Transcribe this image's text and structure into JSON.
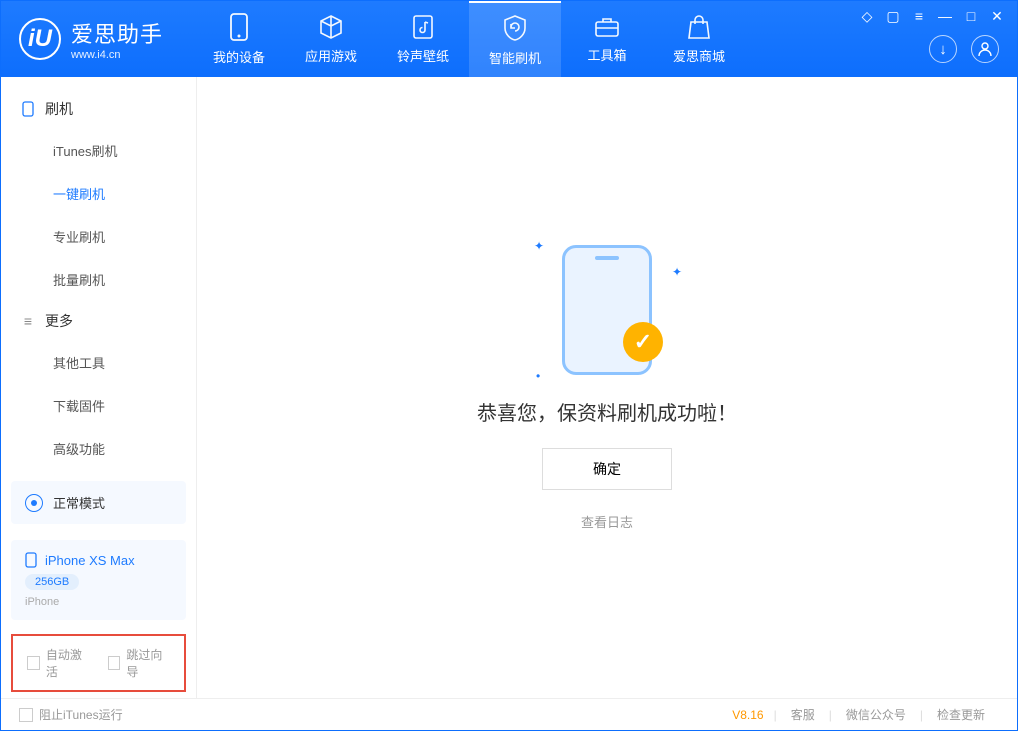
{
  "app": {
    "title": "爱思助手",
    "subtitle": "www.i4.cn"
  },
  "tabs": [
    {
      "label": "我的设备"
    },
    {
      "label": "应用游戏"
    },
    {
      "label": "铃声壁纸"
    },
    {
      "label": "智能刷机"
    },
    {
      "label": "工具箱"
    },
    {
      "label": "爱思商城"
    }
  ],
  "sidebar": {
    "group1": {
      "title": "刷机"
    },
    "items1": [
      {
        "label": "iTunes刷机"
      },
      {
        "label": "一键刷机"
      },
      {
        "label": "专业刷机"
      },
      {
        "label": "批量刷机"
      }
    ],
    "group2": {
      "title": "更多"
    },
    "items2": [
      {
        "label": "其他工具"
      },
      {
        "label": "下载固件"
      },
      {
        "label": "高级功能"
      }
    ],
    "mode": {
      "label": "正常模式"
    },
    "device": {
      "name": "iPhone XS Max",
      "storage": "256GB",
      "type": "iPhone"
    },
    "opts": {
      "auto_activate": "自动激活",
      "skip_guide": "跳过向导"
    }
  },
  "main": {
    "success": "恭喜您，保资料刷机成功啦！",
    "ok": "确定",
    "log": "查看日志"
  },
  "footer": {
    "block_itunes": "阻止iTunes运行",
    "version": "V8.16",
    "service": "客服",
    "wechat": "微信公众号",
    "update": "检查更新"
  }
}
